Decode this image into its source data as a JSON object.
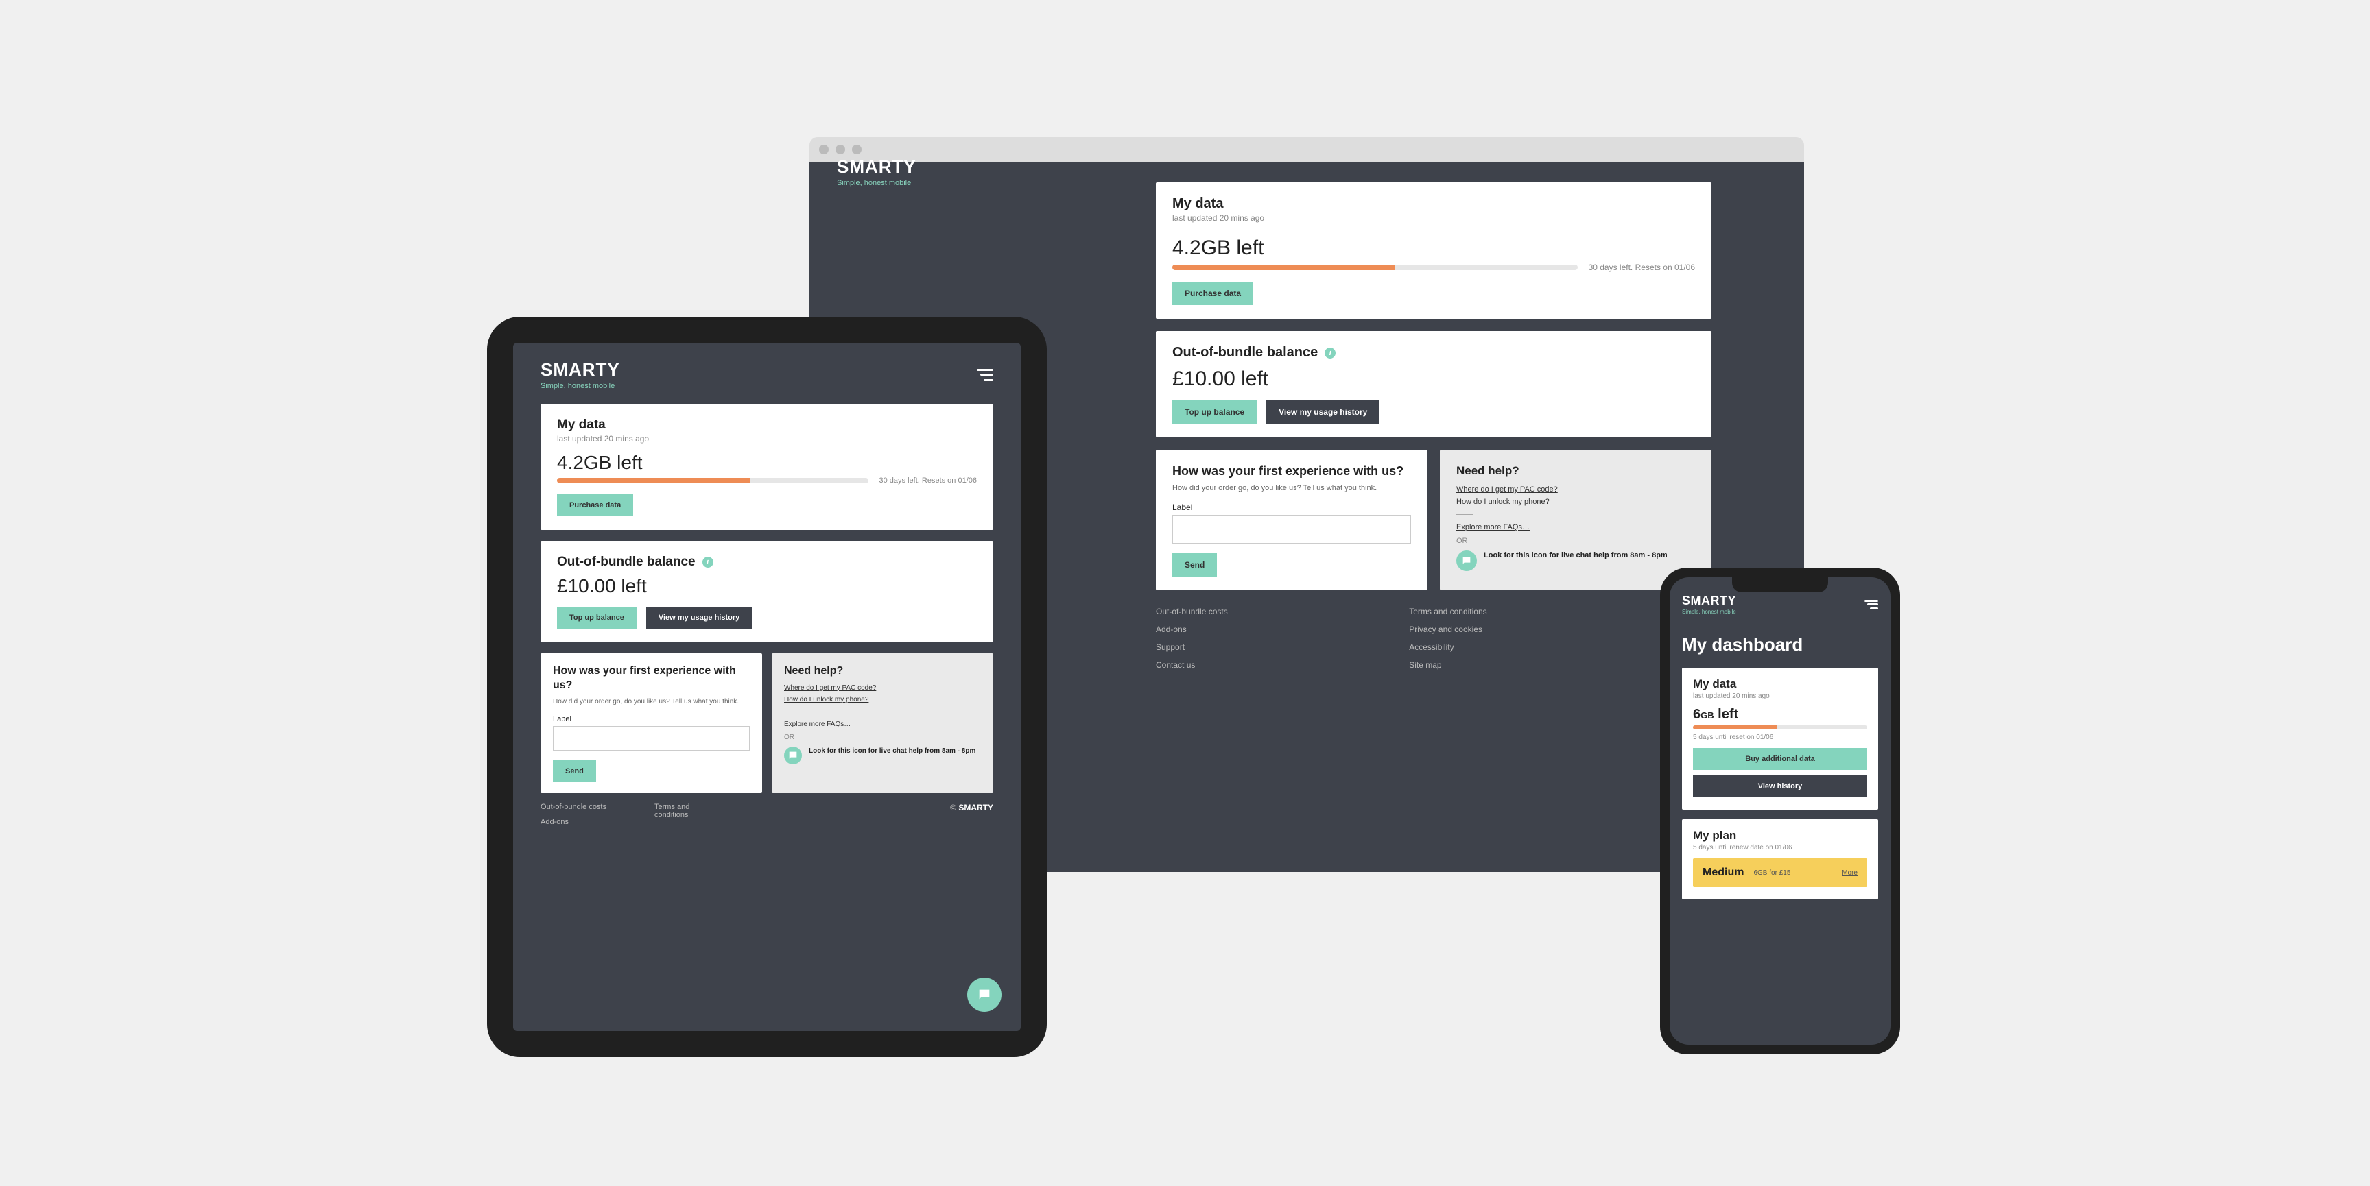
{
  "brand": "SMARTY",
  "tagline": "Simple, honest mobile",
  "copyright_prefix": "©",
  "copyright_brand": "SMARTY",
  "data_card": {
    "title": "My data",
    "updated": "last updated 20 mins ago",
    "amount": "4.2GB left",
    "days_text": "30 days left. Resets on 01/06",
    "purchase": "Purchase data"
  },
  "balance_card": {
    "title": "Out-of-bundle balance",
    "amount": "£10.00 left",
    "topup": "Top up balance",
    "history": "View my usage history"
  },
  "experience_card": {
    "title": "How was your first experience with us?",
    "body": "How did your order go, do you like us? Tell us what you think.",
    "label": "Label",
    "send": "Send"
  },
  "help_card": {
    "title": "Need help?",
    "faq1": "Where do I get my PAC code?",
    "faq2": "How do I unlock my phone?",
    "explore": "Explore more FAQs…",
    "or": "OR",
    "chat": "Look for this icon for live chat help from 8am - 8pm"
  },
  "footer_links": {
    "col1": [
      "Out-of-bundle costs",
      "Add-ons",
      "Support",
      "Contact us"
    ],
    "col2": [
      "Terms and conditions",
      "Privacy and cookies",
      "Accessibility",
      "Site map"
    ]
  },
  "tablet_footer": {
    "col1": [
      "Out-of-bundle costs",
      "Add-ons"
    ],
    "col2": [
      "Terms and conditions"
    ]
  },
  "phone": {
    "dashboard_title": "My dashboard",
    "data_title": "My data",
    "data_updated": "last updated 20 mins ago",
    "data_amount_num": "6",
    "data_amount_unit": "GB",
    "data_amount_suffix": " left",
    "reset_text": "5 days until reset on 01/06",
    "buy": "Buy additional data",
    "history": "View history",
    "plan_title": "My plan",
    "renew_text": "5 days until renew date on 01/06",
    "plan_name": "Medium",
    "plan_detail": "6GB for £15",
    "more": "More"
  }
}
